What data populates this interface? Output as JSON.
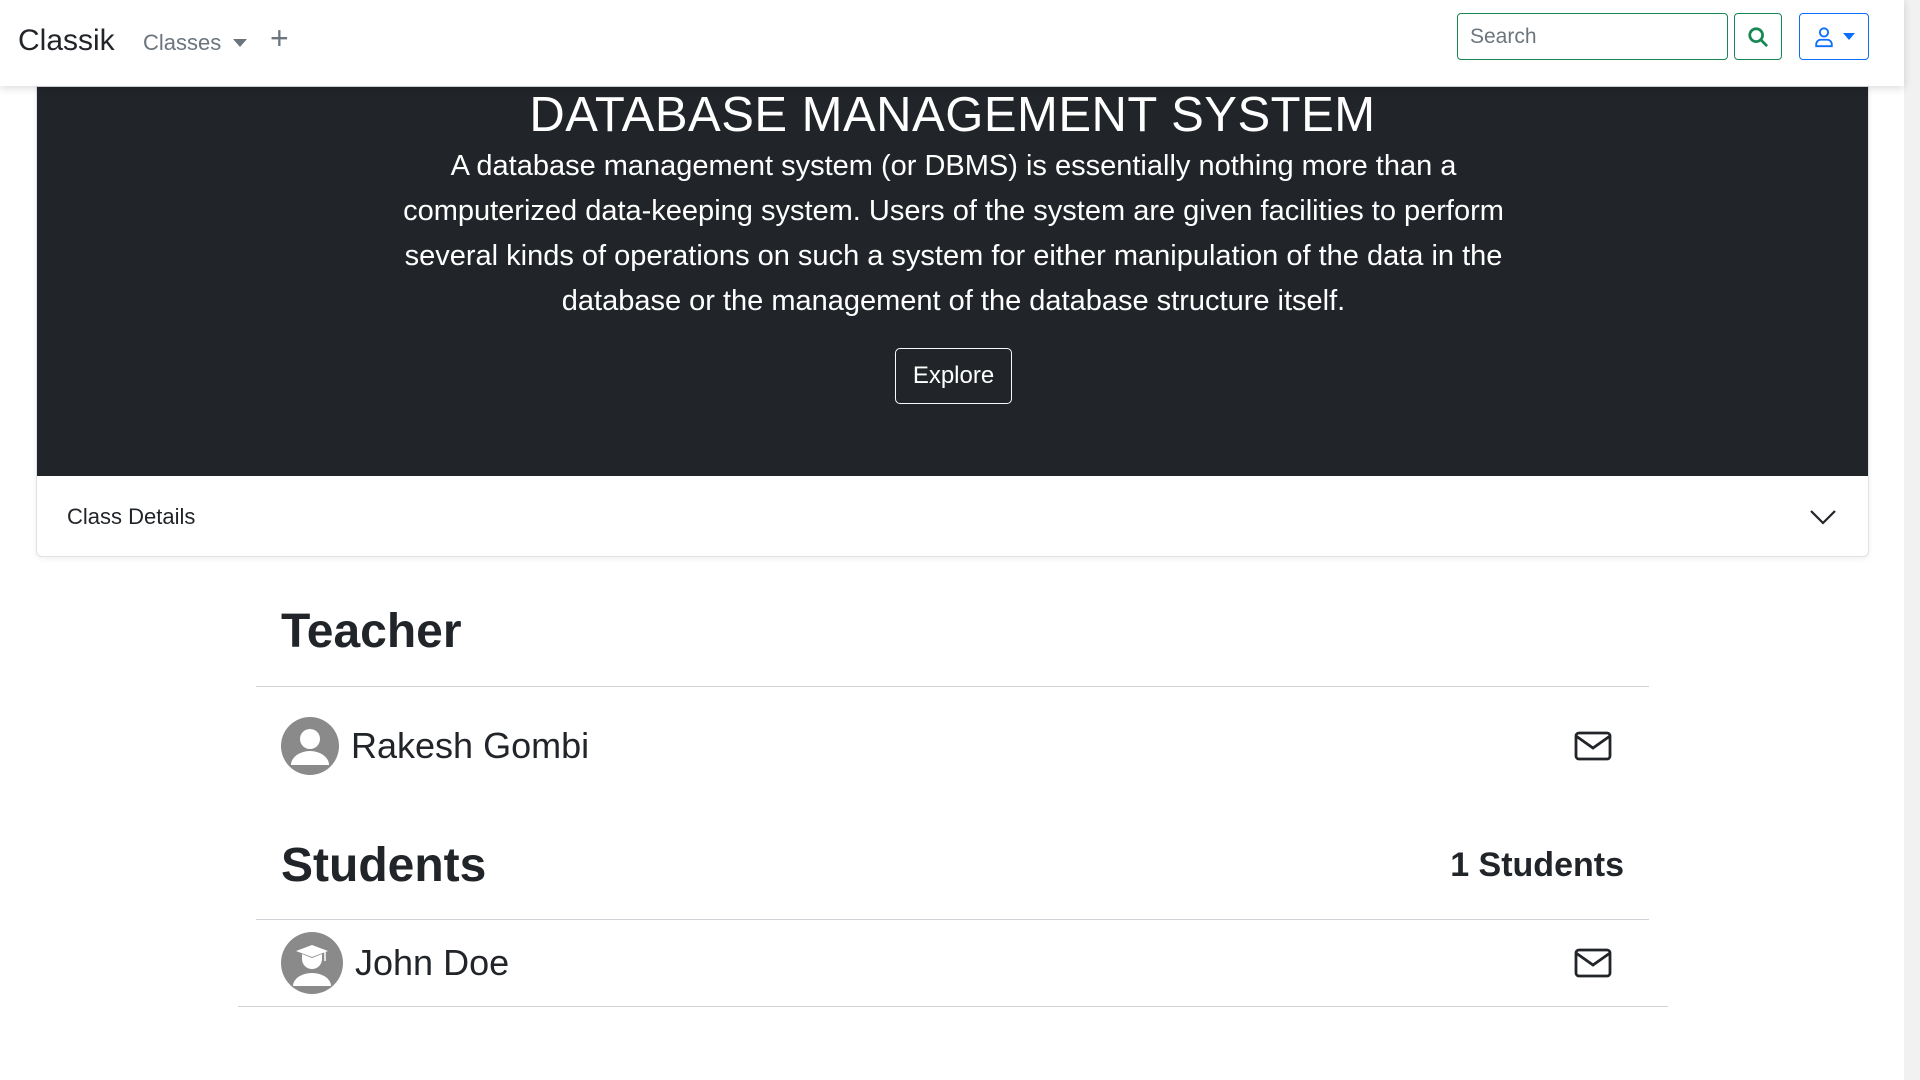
{
  "navbar": {
    "brand": "Classik",
    "classes_label": "Classes",
    "add_label": "+",
    "search_placeholder": "Search"
  },
  "hero": {
    "title": "DATABASE MANAGEMENT SYSTEM",
    "description": "A database management system (or DBMS) is essentially nothing more than a computerized data-keeping system. Users of the system are given facilities to perform several kinds of operations on such a system for either manipulation of the data in the database or the management of the database structure itself.",
    "explore_label": "Explore"
  },
  "class_details": {
    "label": "Class Details"
  },
  "teacher_section": {
    "title": "Teacher",
    "teacher": {
      "name": "Rakesh Gombi"
    }
  },
  "students_section": {
    "title": "Students",
    "count_label": "1 Students",
    "students": [
      {
        "name": "John Doe"
      }
    ]
  },
  "icons": {
    "search": "search-icon",
    "user": "user-icon",
    "chevron": "chevron-down-icon",
    "mail": "envelope-icon",
    "teacher_avatar": "person-avatar-icon",
    "student_avatar": "graduate-avatar-icon"
  },
  "colors": {
    "success": "#198754",
    "primary": "#0d6efd",
    "hero_bg": "#212529"
  }
}
